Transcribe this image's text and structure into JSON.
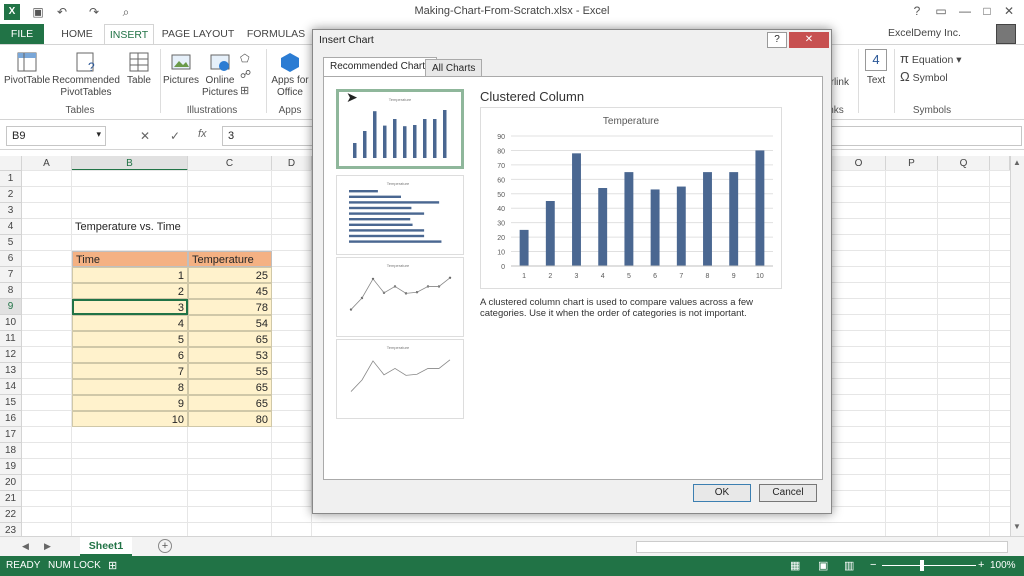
{
  "window": {
    "title": "Making-Chart-From-Scratch.xlsx - Excel",
    "user": "ExcelDemy Inc."
  },
  "tabs": [
    "FILE",
    "HOME",
    "INSERT",
    "PAGE LAYOUT",
    "FORMULAS"
  ],
  "ribbon": {
    "pivottable": "PivotTable",
    "recommended_line1": "Recommended",
    "recommended_line2": "PivotTables",
    "table": "Table",
    "pictures": "Pictures",
    "online_line1": "Online",
    "online_line2": "Pictures",
    "apps_line1": "Apps for",
    "apps_line2": "Office",
    "hyperlink": "erlink",
    "text": "Text",
    "equation": "Equation",
    "symbol": "Symbol",
    "groups": {
      "tables": "Tables",
      "illustrations": "Illustrations",
      "apps": "Apps",
      "links": "nks",
      "symbols": "Symbols"
    }
  },
  "formula_bar": {
    "name_box": "B9",
    "value": "3",
    "fx": "fx"
  },
  "columns_left": [
    "A",
    "B",
    "C",
    "D"
  ],
  "columns_right": [
    "O",
    "P",
    "Q"
  ],
  "rows": [
    "1",
    "2",
    "3",
    "4",
    "5",
    "6",
    "7",
    "8",
    "9",
    "10",
    "11",
    "12",
    "13",
    "14",
    "15",
    "16",
    "17",
    "18",
    "19",
    "20",
    "21",
    "22",
    "23"
  ],
  "sheet": {
    "table_title": "Temperature vs. Time",
    "col1_header": "Time",
    "col2_header": "Temperature",
    "data": [
      [
        "1",
        "25"
      ],
      [
        "2",
        "45"
      ],
      [
        "3",
        "78"
      ],
      [
        "4",
        "54"
      ],
      [
        "5",
        "65"
      ],
      [
        "6",
        "53"
      ],
      [
        "7",
        "55"
      ],
      [
        "8",
        "65"
      ],
      [
        "9",
        "65"
      ],
      [
        "10",
        "80"
      ]
    ],
    "tab_name": "Sheet1"
  },
  "status": {
    "ready": "READY",
    "num_lock": "NUM LOCK",
    "zoom": "100%"
  },
  "dialog": {
    "title": "Insert Chart",
    "tab_recommended": "Recommended Charts",
    "tab_all": "All Charts",
    "chart_name": "Clustered Column",
    "description": "A clustered column chart is used to compare values across a few categories. Use it when the order of categories is not important.",
    "ok": "OK",
    "cancel": "Cancel",
    "help": "?",
    "close": "✕"
  },
  "colors": {
    "excel_green": "#217346",
    "bar": "#4a6791",
    "header_fill": "#f4b183",
    "data_fill": "#fff2cc"
  },
  "chart_data": {
    "type": "bar",
    "title": "Temperature",
    "categories": [
      "1",
      "2",
      "3",
      "4",
      "5",
      "6",
      "7",
      "8",
      "9",
      "10"
    ],
    "values": [
      25,
      45,
      78,
      54,
      65,
      53,
      55,
      65,
      65,
      80
    ],
    "yticks": [
      "0",
      "10",
      "20",
      "30",
      "40",
      "50",
      "60",
      "70",
      "80",
      "90"
    ],
    "ylim": [
      0,
      90
    ],
    "grid": true,
    "legend": false
  }
}
